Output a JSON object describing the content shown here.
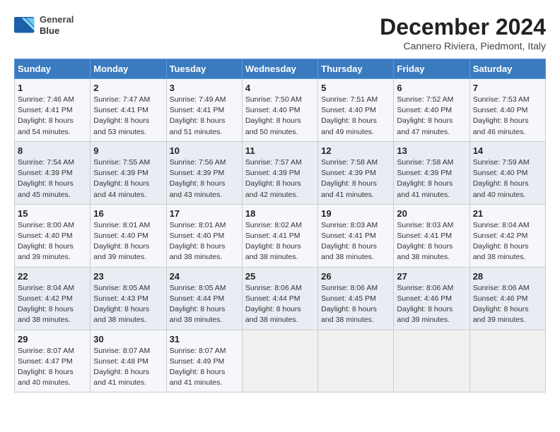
{
  "logo": {
    "line1": "General",
    "line2": "Blue"
  },
  "title": "December 2024",
  "location": "Cannero Riviera, Piedmont, Italy",
  "weekdays": [
    "Sunday",
    "Monday",
    "Tuesday",
    "Wednesday",
    "Thursday",
    "Friday",
    "Saturday"
  ],
  "weeks": [
    [
      {
        "day": "1",
        "info": "Sunrise: 7:46 AM\nSunset: 4:41 PM\nDaylight: 8 hours\nand 54 minutes."
      },
      {
        "day": "2",
        "info": "Sunrise: 7:47 AM\nSunset: 4:41 PM\nDaylight: 8 hours\nand 53 minutes."
      },
      {
        "day": "3",
        "info": "Sunrise: 7:49 AM\nSunset: 4:41 PM\nDaylight: 8 hours\nand 51 minutes."
      },
      {
        "day": "4",
        "info": "Sunrise: 7:50 AM\nSunset: 4:40 PM\nDaylight: 8 hours\nand 50 minutes."
      },
      {
        "day": "5",
        "info": "Sunrise: 7:51 AM\nSunset: 4:40 PM\nDaylight: 8 hours\nand 49 minutes."
      },
      {
        "day": "6",
        "info": "Sunrise: 7:52 AM\nSunset: 4:40 PM\nDaylight: 8 hours\nand 47 minutes."
      },
      {
        "day": "7",
        "info": "Sunrise: 7:53 AM\nSunset: 4:40 PM\nDaylight: 8 hours\nand 46 minutes."
      }
    ],
    [
      {
        "day": "8",
        "info": "Sunrise: 7:54 AM\nSunset: 4:39 PM\nDaylight: 8 hours\nand 45 minutes."
      },
      {
        "day": "9",
        "info": "Sunrise: 7:55 AM\nSunset: 4:39 PM\nDaylight: 8 hours\nand 44 minutes."
      },
      {
        "day": "10",
        "info": "Sunrise: 7:56 AM\nSunset: 4:39 PM\nDaylight: 8 hours\nand 43 minutes."
      },
      {
        "day": "11",
        "info": "Sunrise: 7:57 AM\nSunset: 4:39 PM\nDaylight: 8 hours\nand 42 minutes."
      },
      {
        "day": "12",
        "info": "Sunrise: 7:58 AM\nSunset: 4:39 PM\nDaylight: 8 hours\nand 41 minutes."
      },
      {
        "day": "13",
        "info": "Sunrise: 7:58 AM\nSunset: 4:39 PM\nDaylight: 8 hours\nand 41 minutes."
      },
      {
        "day": "14",
        "info": "Sunrise: 7:59 AM\nSunset: 4:40 PM\nDaylight: 8 hours\nand 40 minutes."
      }
    ],
    [
      {
        "day": "15",
        "info": "Sunrise: 8:00 AM\nSunset: 4:40 PM\nDaylight: 8 hours\nand 39 minutes."
      },
      {
        "day": "16",
        "info": "Sunrise: 8:01 AM\nSunset: 4:40 PM\nDaylight: 8 hours\nand 39 minutes."
      },
      {
        "day": "17",
        "info": "Sunrise: 8:01 AM\nSunset: 4:40 PM\nDaylight: 8 hours\nand 38 minutes."
      },
      {
        "day": "18",
        "info": "Sunrise: 8:02 AM\nSunset: 4:41 PM\nDaylight: 8 hours\nand 38 minutes."
      },
      {
        "day": "19",
        "info": "Sunrise: 8:03 AM\nSunset: 4:41 PM\nDaylight: 8 hours\nand 38 minutes."
      },
      {
        "day": "20",
        "info": "Sunrise: 8:03 AM\nSunset: 4:41 PM\nDaylight: 8 hours\nand 38 minutes."
      },
      {
        "day": "21",
        "info": "Sunrise: 8:04 AM\nSunset: 4:42 PM\nDaylight: 8 hours\nand 38 minutes."
      }
    ],
    [
      {
        "day": "22",
        "info": "Sunrise: 8:04 AM\nSunset: 4:42 PM\nDaylight: 8 hours\nand 38 minutes."
      },
      {
        "day": "23",
        "info": "Sunrise: 8:05 AM\nSunset: 4:43 PM\nDaylight: 8 hours\nand 38 minutes."
      },
      {
        "day": "24",
        "info": "Sunrise: 8:05 AM\nSunset: 4:44 PM\nDaylight: 8 hours\nand 38 minutes."
      },
      {
        "day": "25",
        "info": "Sunrise: 8:06 AM\nSunset: 4:44 PM\nDaylight: 8 hours\nand 38 minutes."
      },
      {
        "day": "26",
        "info": "Sunrise: 8:06 AM\nSunset: 4:45 PM\nDaylight: 8 hours\nand 38 minutes."
      },
      {
        "day": "27",
        "info": "Sunrise: 8:06 AM\nSunset: 4:46 PM\nDaylight: 8 hours\nand 39 minutes."
      },
      {
        "day": "28",
        "info": "Sunrise: 8:06 AM\nSunset: 4:46 PM\nDaylight: 8 hours\nand 39 minutes."
      }
    ],
    [
      {
        "day": "29",
        "info": "Sunrise: 8:07 AM\nSunset: 4:47 PM\nDaylight: 8 hours\nand 40 minutes."
      },
      {
        "day": "30",
        "info": "Sunrise: 8:07 AM\nSunset: 4:48 PM\nDaylight: 8 hours\nand 41 minutes."
      },
      {
        "day": "31",
        "info": "Sunrise: 8:07 AM\nSunset: 4:49 PM\nDaylight: 8 hours\nand 41 minutes."
      },
      {
        "day": "",
        "info": ""
      },
      {
        "day": "",
        "info": ""
      },
      {
        "day": "",
        "info": ""
      },
      {
        "day": "",
        "info": ""
      }
    ]
  ]
}
